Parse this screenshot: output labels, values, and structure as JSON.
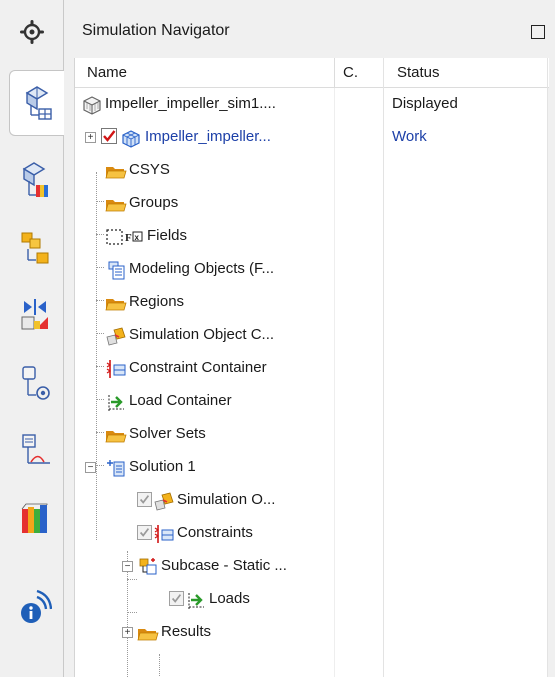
{
  "sidebar": {
    "tabs": [
      {
        "name": "settings-gear"
      },
      {
        "name": "simulation-navigator"
      },
      {
        "name": "fem-navigator"
      },
      {
        "name": "part-navigator"
      },
      {
        "name": "assembly-constraints"
      },
      {
        "name": "sensors"
      },
      {
        "name": "post-processing"
      },
      {
        "name": "reuse-library"
      },
      {
        "name": "information-broadcast"
      }
    ]
  },
  "panel": {
    "title": "Simulation Navigator"
  },
  "columns": {
    "name": "Name",
    "c": "C.",
    "status": "Status"
  },
  "tree": {
    "rows": [
      {
        "label": "Impeller_impeller_sim1....",
        "status": "Displayed",
        "icon": "sim-file-icon"
      },
      {
        "label": "Impeller_impeller...",
        "status": "Work",
        "icon": "fem-mesh-icon"
      },
      {
        "label": "CSYS",
        "status": "",
        "icon": "folder-icon"
      },
      {
        "label": "Groups",
        "status": "",
        "icon": "folder-icon"
      },
      {
        "label": "Fields",
        "status": "",
        "icon": "fields-icon"
      },
      {
        "label": "Modeling Objects (F...",
        "status": "",
        "icon": "modeling-objects-icon"
      },
      {
        "label": "Regions",
        "status": "",
        "icon": "folder-icon"
      },
      {
        "label": "Simulation Object C...",
        "status": "",
        "icon": "simulation-object-icon"
      },
      {
        "label": "Constraint Container",
        "status": "",
        "icon": "constraint-icon"
      },
      {
        "label": "Load Container",
        "status": "",
        "icon": "load-icon"
      },
      {
        "label": "Solver Sets",
        "status": "",
        "icon": "folder-icon"
      },
      {
        "label": "Solution 1",
        "status": "",
        "icon": "solution-icon"
      },
      {
        "label": "Simulation O...",
        "status": "",
        "icon": "simulation-object-icon"
      },
      {
        "label": "Constraints",
        "status": "",
        "icon": "constraint-icon"
      },
      {
        "label": "Subcase - Static ...",
        "status": "",
        "icon": "subcase-icon"
      },
      {
        "label": "Loads",
        "status": "",
        "icon": "load-icon"
      },
      {
        "label": "Results",
        "status": "",
        "icon": "folder-icon"
      }
    ]
  },
  "colors": {
    "accent_blue": "#1d40a8",
    "folder_orange": "#f0a020",
    "check_red": "#d11515"
  }
}
